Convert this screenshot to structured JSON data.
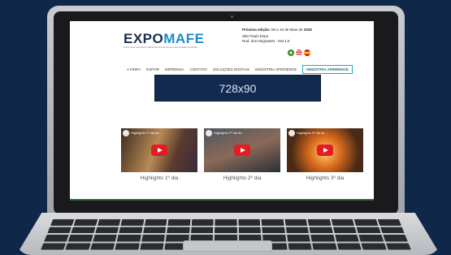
{
  "site": {
    "logo_main": "EXPO",
    "logo_accent": "MAFE",
    "tagline": "Feira Internacional de Máquinas-Ferramenta e Automação Industrial",
    "edition_label": "Próxima edição:",
    "edition_dates": "06 a 10 de Maio de",
    "edition_year": "2025",
    "venue_line1": "São Paulo Expo",
    "venue_line2": "Rod. dos Imigrantes - KM 1,5"
  },
  "nav": {
    "items": [
      "A FEIRA",
      "EXPOR",
      "IMPRENSA",
      "CONTATO",
      "SOLUÇÕES DIGITAIS",
      "INDÚSTRIA XPERIENCE"
    ],
    "active": "INDÚSTRIA XPERIENCE"
  },
  "ad": {
    "label": "728x90"
  },
  "videos": [
    {
      "title": "Highlights 1º dia do...",
      "caption": "Highlights 1º dia"
    },
    {
      "title": "Highlights 2º dia do...",
      "caption": "Highlights 2º dia"
    },
    {
      "title": "Highlights 3º dia do...",
      "caption": "Highlights 3º dia"
    }
  ],
  "colors": {
    "background": "#0f2749",
    "brand_dark": "#1c2c4c",
    "brand_accent": "#1d8bc9",
    "ad_background": "#132a4f",
    "active_nav_border": "#2aa7b8",
    "play_button": "#e31b23"
  },
  "flags": [
    "brazil-flag",
    "usa-flag",
    "spain-flag"
  ]
}
